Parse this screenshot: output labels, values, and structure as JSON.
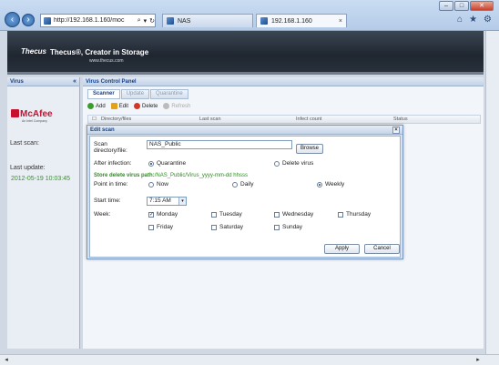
{
  "browser": {
    "address": "http://192.168.1.160/moc",
    "tabs": [
      {
        "label": "NAS",
        "active": false
      },
      {
        "label": "192.168.1.160",
        "active": true
      }
    ],
    "window_buttons": [
      "–",
      "□",
      "✕"
    ],
    "right_icons": [
      "⌂",
      "★",
      "⚙"
    ]
  },
  "header": {
    "logo": "Thecus",
    "tagline": "Thecus®, Creator in Storage",
    "url": "www.thecus.com"
  },
  "left_panel": {
    "title": "Virus",
    "collapse": "«",
    "brand": "McAfee",
    "brand_sub": "An Intel Company",
    "last_scan_label": "Last scan:",
    "last_update_label": "Last update:",
    "last_update_value": "2012-05-19 10:03:45"
  },
  "main_panel": {
    "title": "Virus Control Panel",
    "tabs": [
      "Scanner",
      "Update",
      "Quarantine"
    ],
    "toolbar": {
      "add": "Add",
      "edit": "Edit",
      "delete": "Delete",
      "refresh": "Refresh"
    },
    "columns": [
      "Directory/files",
      "Last scan",
      "Infect count",
      "Status"
    ]
  },
  "modal": {
    "title": "Edit scan",
    "close": "×",
    "scan_label_1": "Scan",
    "scan_label_2": "directory/file:",
    "scan_value": "NAS_Public",
    "browse": "Browse",
    "after_infection_label": "After infection:",
    "quarantine": "Quarantine",
    "delete_virus": "Delete virus",
    "store_label": "Store delete virus path:",
    "store_path": "/NAS_Public/Virus_yyyy-mm-dd hhsss",
    "point_label": "Point in time:",
    "now": "Now",
    "daily": "Daily",
    "weekly": "Weekly",
    "start_label": "Start time:",
    "start_value": "7:15 AM",
    "week_label": "Week:",
    "days": [
      "Monday",
      "Tuesday",
      "Wednesday",
      "Thursday",
      "Friday",
      "Saturday",
      "Sunday"
    ],
    "checked_day": "Monday",
    "apply": "Apply",
    "cancel": "Cancel"
  }
}
